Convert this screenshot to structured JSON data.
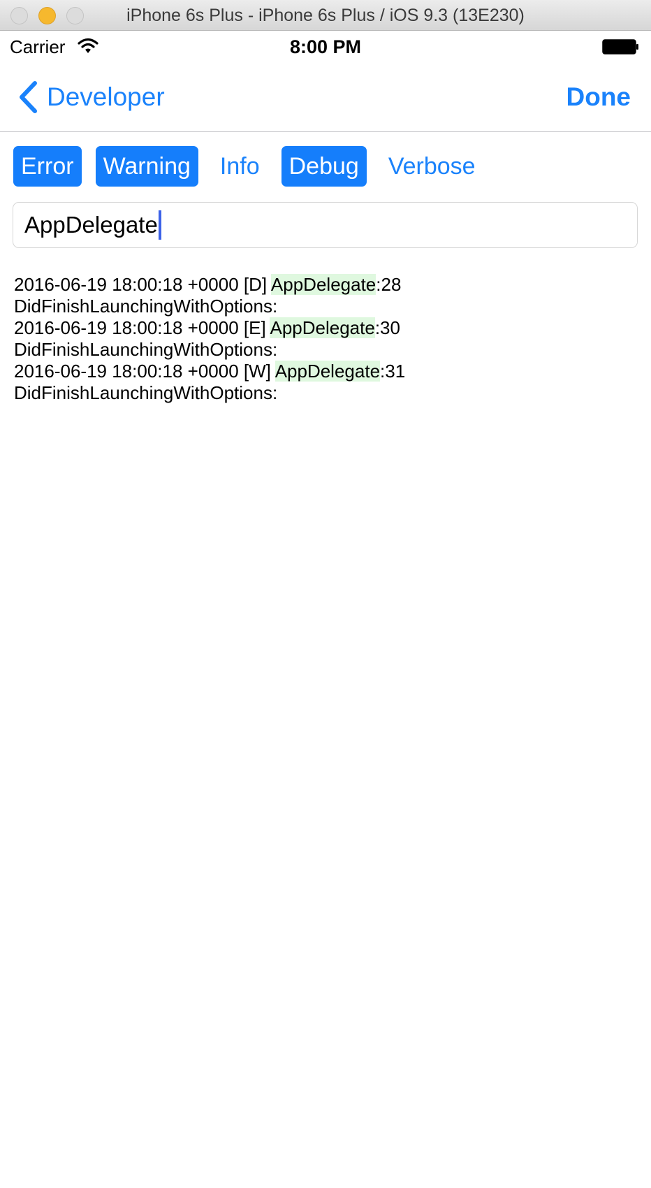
{
  "window": {
    "title": "iPhone 6s Plus - iPhone 6s Plus / iOS 9.3 (13E230)"
  },
  "status_bar": {
    "carrier": "Carrier",
    "time": "8:00 PM"
  },
  "nav": {
    "back_label": "Developer",
    "done_label": "Done",
    "tint": "#1a82fb"
  },
  "filters": [
    {
      "label": "Error",
      "selected": true
    },
    {
      "label": "Warning",
      "selected": true
    },
    {
      "label": "Info",
      "selected": false
    },
    {
      "label": "Debug",
      "selected": true
    },
    {
      "label": "Verbose",
      "selected": false
    }
  ],
  "search": {
    "value": "AppDelegate"
  },
  "log": {
    "highlight_color": "#dff8df",
    "entries": [
      {
        "prefix": "2016-06-19 18:00:18 +0000 [D] ",
        "match": "AppDelegate",
        "suffix": ":28",
        "message": "DidFinishLaunchingWithOptions:"
      },
      {
        "prefix": "2016-06-19 18:00:18 +0000 [E] ",
        "match": "AppDelegate",
        "suffix": ":30",
        "message": "DidFinishLaunchingWithOptions:"
      },
      {
        "prefix": "2016-06-19 18:00:18 +0000 [W] ",
        "match": "AppDelegate",
        "suffix": ":31",
        "message": "DidFinishLaunchingWithOptions:"
      }
    ]
  }
}
